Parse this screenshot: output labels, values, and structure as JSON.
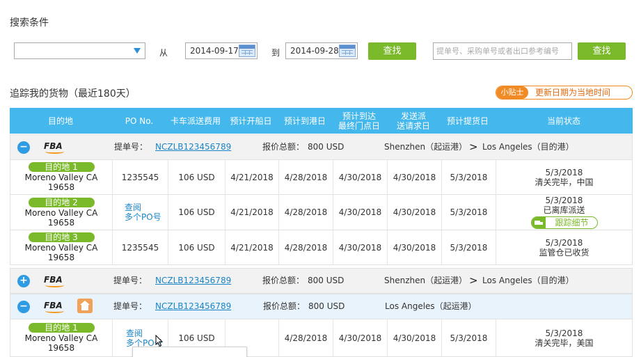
{
  "search": {
    "title": "搜索条件",
    "from_label": "从",
    "to_label": "到",
    "date_from": "2014-09-17",
    "date_to": "2014-09-28",
    "find_button": "查找",
    "ref_placeholder": "提单号、采购单号或者出口参考编号",
    "find_button_2": "查找"
  },
  "tracking": {
    "title": "追踪我的货物（最近180天）",
    "tip_tag": "小贴士",
    "tip_text": "更新日期为当地时间"
  },
  "table": {
    "headers": [
      "目的地",
      "PO No.",
      "卡车派送费用",
      "预计开船日",
      "预计到港日",
      "预计到达\n最终门点日",
      "发送派\n送请求日",
      "预计提货日",
      "当前状态"
    ]
  },
  "groups": [
    {
      "toggle": "−",
      "logo": "FBA",
      "bl_label": "提单号：",
      "bl_number": "NCZLB123456789",
      "quote_label": "报价总额：",
      "quote_value": "800 USD",
      "origin": "Shenzhen（起运港）",
      "arrow": ">",
      "destination": "Los Angeles（目的港）",
      "rows": [
        {
          "dest_tag": "目的地 1",
          "address": "Moreno Valley CA 19658",
          "po": "1235545",
          "fee": "106 USD",
          "d1": "4/21/2018",
          "d2": "4/28/2018",
          "d3": "4/30/2018",
          "d4": "4/30/2018",
          "d5": "5/3/2018",
          "status_date": "5/3/2018",
          "status": "清关完毕，中国"
        },
        {
          "dest_tag": "目的地 2",
          "address": "Moreno Valley CA 19658",
          "po_link_1": "查阅",
          "po_link_2": "多个PO号",
          "fee": "106 USD",
          "d1": "4/21/2018",
          "d2": "4/28/2018",
          "d3": "4/30/2018",
          "d4": "4/30/2018",
          "d5": "5/3/2018",
          "status_date": "5/3/2018",
          "status": "已离库派送",
          "track_button": "跟踪细节"
        },
        {
          "dest_tag": "目的地 3",
          "address": "Moreno Valley CA 19658",
          "po": "1235545",
          "fee": "106 USD",
          "d1": "4/21/2018",
          "d2": "4/28/2018",
          "d3": "4/30/2018",
          "d4": "4/30/2018",
          "d5": "5/3/2018",
          "status_date": "5/3/2018",
          "status": "监管仓已收货"
        }
      ]
    },
    {
      "toggle": "+",
      "logo": "FBA",
      "bl_label": "提单号：",
      "bl_number": "NCZLB123456789",
      "quote_label": "报价总额：",
      "quote_value": "800 USD",
      "origin": "Shenzhen（起运港）",
      "arrow": ">",
      "destination": "Los Angeles（目的港）"
    },
    {
      "toggle": "−",
      "logo": "FBA",
      "bl_label": "提单号：",
      "bl_number": "NCZLB123456789",
      "quote_label": "报价总额：",
      "quote_value": "800 USD",
      "origin": "Los Angeles（起运港）",
      "rows": [
        {
          "dest_tag": "目的地 1",
          "address": "Moreno Valley CA 19658",
          "po_link_1": "查阅",
          "po_link_2": "多个PO号",
          "fee": "106 USD",
          "d1": "",
          "d2": "4/28/2018",
          "d3": "4/30/2018",
          "d4": "4/30/2018",
          "d5": "5/3/2018",
          "status_date": "5/3/2018",
          "status": "清关完毕，美国"
        }
      ]
    }
  ],
  "colors": {
    "header_blue": "#44b7ec",
    "accent_green": "#7ab929",
    "tip_orange": "#f08a24",
    "link_blue": "#1a84c8"
  }
}
